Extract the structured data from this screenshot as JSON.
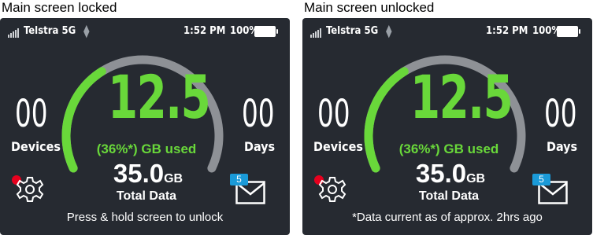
{
  "captions": {
    "locked": "Main screen locked",
    "unlocked": "Main screen unlocked"
  },
  "colors": {
    "screen_bg": "#262a31",
    "accent_green": "#69d83a",
    "gauge_track": "#8e9196",
    "notification_dot": "#e6001e",
    "badge_blue": "#1a9ad8"
  },
  "screens": {
    "locked": {
      "status": {
        "carrier": "Telstra 5G",
        "time": "1:52 PM",
        "battery_pct": "100%"
      },
      "devices": {
        "count": "00",
        "label": "Devices"
      },
      "days": {
        "count": "00",
        "label": "Days"
      },
      "usage": {
        "used_value": "12.5",
        "used_label": "(36%*) GB used",
        "used_fraction": 0.36
      },
      "total": {
        "value": "35.0",
        "unit": "GB",
        "label": "Total Data"
      },
      "footer": "Press & hold screen to unlock",
      "messages_badge": "5",
      "icons": {
        "settings": "gear-icon",
        "messages": "envelope-icon",
        "signal": "signal-bars-icon",
        "network": "updown-arrows-icon",
        "battery": "battery-icon"
      }
    },
    "unlocked": {
      "status": {
        "carrier": "Telstra 5G",
        "time": "1:52 PM",
        "battery_pct": "100%"
      },
      "devices": {
        "count": "00",
        "label": "Devices"
      },
      "days": {
        "count": "00",
        "label": "Days"
      },
      "usage": {
        "used_value": "12.5",
        "used_label": "(36%*) GB used",
        "used_fraction": 0.36
      },
      "total": {
        "value": "35.0",
        "unit": "GB",
        "label": "Total Data"
      },
      "footer": "*Data current as of approx. 2hrs ago",
      "messages_badge": "5",
      "icons": {
        "settings": "gear-icon",
        "messages": "envelope-icon",
        "signal": "signal-bars-icon",
        "network": "updown-arrows-icon",
        "battery": "battery-icon"
      }
    }
  }
}
